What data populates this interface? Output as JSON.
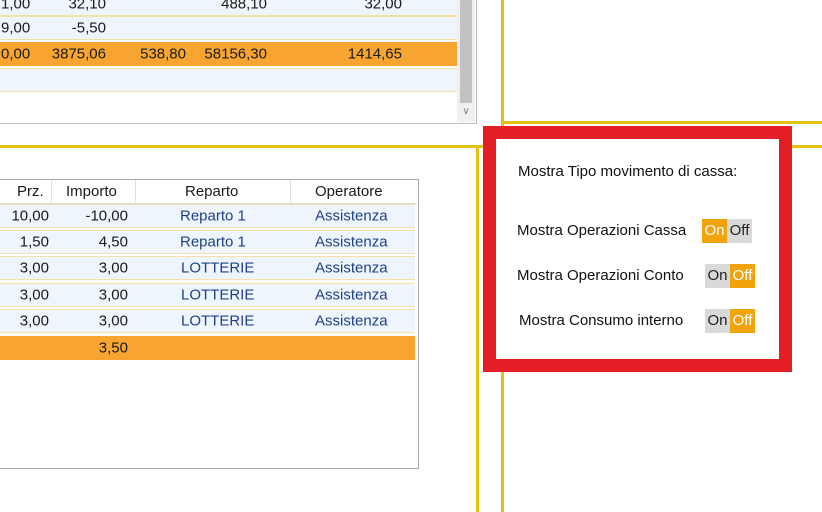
{
  "top_table": {
    "rows": [
      {
        "c1": "1,00",
        "c2": "32,10",
        "c3": "",
        "c4": "488,10",
        "c5": "32,00",
        "style": "light"
      },
      {
        "c1": "9,00",
        "c2": "-5,50",
        "c3": "",
        "c4": "",
        "c5": "",
        "style": "light"
      },
      {
        "c1": "0,00",
        "c2": "3875,06",
        "c3": "538,80",
        "c4": "58156,30",
        "c5": "1414,65",
        "style": "orange"
      },
      {
        "c1": "",
        "c2": "",
        "c3": "",
        "c4": "",
        "c5": "",
        "style": "empty"
      }
    ]
  },
  "bottom_table": {
    "headers": {
      "prz": "Prz.",
      "importo": "Importo",
      "reparto": "Reparto",
      "operatore": "Operatore"
    },
    "rows": [
      {
        "prz": "10,00",
        "importo": "-10,00",
        "reparto": "Reparto 1",
        "operatore": "Assistenza"
      },
      {
        "prz": "1,50",
        "importo": "4,50",
        "reparto": "Reparto 1",
        "operatore": "Assistenza"
      },
      {
        "prz": "3,00",
        "importo": "3,00",
        "reparto": "LOTTERIE",
        "operatore": "Assistenza"
      },
      {
        "prz": "3,00",
        "importo": "3,00",
        "reparto": "LOTTERIE",
        "operatore": "Assistenza"
      },
      {
        "prz": "3,00",
        "importo": "3,00",
        "reparto": "LOTTERIE",
        "operatore": "Assistenza"
      }
    ],
    "total": {
      "importo": "3,50"
    }
  },
  "settings": {
    "title": "Mostra Tipo movimento di cassa:",
    "on_label": "On",
    "off_label": "Off",
    "options": [
      {
        "label": "Mostra Operazioni Cassa",
        "state": "on"
      },
      {
        "label": "Mostra Operazioni Conto",
        "state": "off"
      },
      {
        "label": "Mostra Consumo interno",
        "state": "off"
      }
    ]
  },
  "colors": {
    "accent_yellow": "#e3c10c",
    "highlight_red": "#e31e24",
    "toggle_active": "#f0a30a",
    "row_total": "#f7a530",
    "text_blue": "#1f3f8a"
  }
}
